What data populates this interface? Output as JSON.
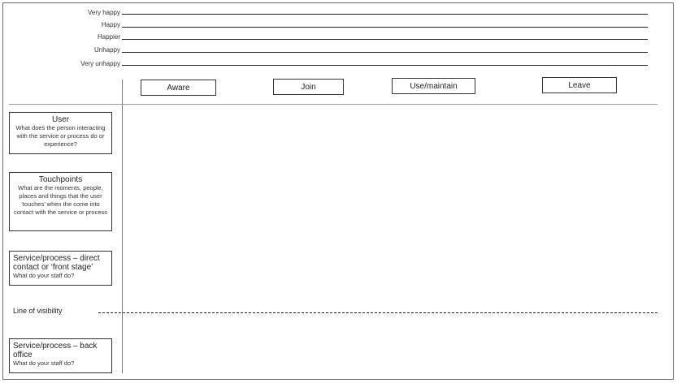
{
  "emotions": [
    "Very happy",
    "Happy",
    "Happier",
    "Unhappy",
    "Very unhappy"
  ],
  "stages": [
    "Aware",
    "Join",
    "Use/maintain",
    "Leave"
  ],
  "rows": {
    "user": {
      "title": "User",
      "desc": "What does the person interacting with the service or process do or experience?"
    },
    "touchpoints": {
      "title": "Touchpoints",
      "desc": "What are the moments, people, places and things that the user ‘touches’ when the come into contact with the service or process"
    },
    "front_stage": {
      "title": "Service/process – direct contact or ‘front stage’",
      "desc": "What do your staff do?"
    },
    "visibility": {
      "label": "Line of visibility"
    },
    "back_office": {
      "title": "Service/process – back office",
      "desc": "What do your staff do?"
    }
  }
}
